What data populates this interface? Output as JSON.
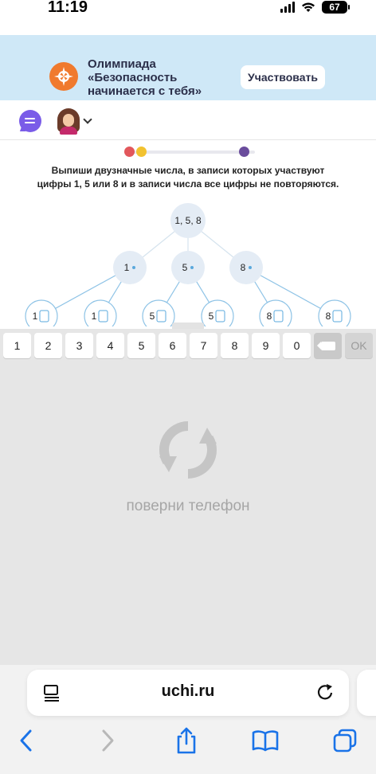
{
  "status_bar": {
    "time": "11:19",
    "battery": "67"
  },
  "banner": {
    "title_line1": "Олимпиада",
    "title_line2": "«Безопасность",
    "title_line3": "начинается с тебя»",
    "button_label": "Участвовать"
  },
  "task": {
    "line1": "Выпиши двузначные числа, в записи которых участвуют",
    "line2": "цифры 1, 5 или 8 и в записи числа все цифры  не повторяются."
  },
  "tree": {
    "root": "1, 5, 8",
    "level1": [
      "1",
      "5",
      "8"
    ],
    "level2": [
      "1",
      "1",
      "5",
      "5",
      "8",
      "8"
    ]
  },
  "keypad": {
    "keys": [
      "1",
      "2",
      "3",
      "4",
      "5",
      "6",
      "7",
      "8",
      "9",
      "0"
    ],
    "ok_label": "OK"
  },
  "rotate_message": "поверни телефон",
  "browser": {
    "url": "uchi.ru"
  },
  "colors": {
    "banner_bg": "#cfe8f7",
    "node_fill": "#e4ecf5",
    "edge": "#8ec3e6",
    "progress_dot_1": "#e2575c",
    "progress_dot_2": "#f2c230",
    "progress_dot_3": "#6a4c9c",
    "ios_blue": "#1a73e8"
  },
  "icons": [
    "signal-icon",
    "wifi-icon",
    "battery-icon",
    "olympiad-logo-icon",
    "chat-icon",
    "avatar",
    "chevron-down-icon",
    "backspace-icon",
    "rotate-phone-icon",
    "reader-icon",
    "reload-icon",
    "back-icon",
    "forward-icon",
    "share-icon",
    "bookmarks-icon",
    "tabs-icon"
  ]
}
